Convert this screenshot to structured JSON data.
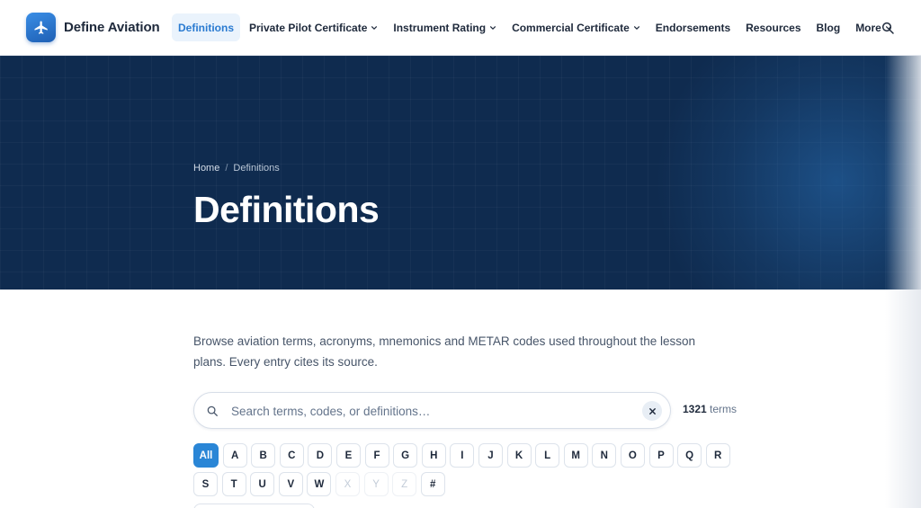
{
  "brand": {
    "name": "Define Aviation",
    "logo_icon": "airplane-icon",
    "accent": "#2a86d6"
  },
  "nav": {
    "items": [
      {
        "label": "Definitions",
        "active": true,
        "dropdown": false
      },
      {
        "label": "Private Pilot Certificate",
        "active": false,
        "dropdown": true
      },
      {
        "label": "Instrument Rating",
        "active": false,
        "dropdown": true
      },
      {
        "label": "Commercial Certificate",
        "active": false,
        "dropdown": true
      },
      {
        "label": "Endorsements",
        "active": false,
        "dropdown": false
      },
      {
        "label": "Resources",
        "active": false,
        "dropdown": false
      },
      {
        "label": "Blog",
        "active": false,
        "dropdown": false
      },
      {
        "label": "More",
        "active": false,
        "dropdown": true
      }
    ],
    "search_icon": "search-icon"
  },
  "hero": {
    "breadcrumb": {
      "home": "Home",
      "separator": "/",
      "current": "Definitions"
    },
    "title": "Definitions",
    "background": "#0f2b4f"
  },
  "intro": "Browse aviation terms, acronyms, mnemonics and METAR codes used throughout the lesson plans. Every entry cites its source.",
  "search": {
    "placeholder": "Search terms, codes, or definitions…",
    "value": "",
    "clear_icon": "close-icon"
  },
  "term_count": {
    "number": "1321",
    "label": "terms"
  },
  "alphabet": {
    "row1": [
      {
        "label": "All",
        "state": "active"
      },
      {
        "label": "A",
        "state": "enabled"
      },
      {
        "label": "B",
        "state": "enabled"
      },
      {
        "label": "C",
        "state": "enabled"
      },
      {
        "label": "D",
        "state": "enabled"
      },
      {
        "label": "E",
        "state": "enabled"
      },
      {
        "label": "F",
        "state": "enabled"
      },
      {
        "label": "G",
        "state": "enabled"
      },
      {
        "label": "H",
        "state": "enabled"
      },
      {
        "label": "I",
        "state": "enabled"
      },
      {
        "label": "J",
        "state": "enabled"
      },
      {
        "label": "K",
        "state": "enabled"
      },
      {
        "label": "L",
        "state": "enabled"
      },
      {
        "label": "M",
        "state": "enabled"
      },
      {
        "label": "N",
        "state": "enabled"
      },
      {
        "label": "O",
        "state": "enabled"
      },
      {
        "label": "P",
        "state": "enabled"
      },
      {
        "label": "Q",
        "state": "enabled"
      },
      {
        "label": "R",
        "state": "enabled"
      }
    ],
    "row2": [
      {
        "label": "S",
        "state": "enabled"
      },
      {
        "label": "T",
        "state": "enabled"
      },
      {
        "label": "U",
        "state": "enabled"
      },
      {
        "label": "V",
        "state": "enabled"
      },
      {
        "label": "W",
        "state": "enabled"
      },
      {
        "label": "X",
        "state": "disabled"
      },
      {
        "label": "Y",
        "state": "disabled"
      },
      {
        "label": "Z",
        "state": "disabled"
      },
      {
        "label": "#",
        "state": "enabled"
      }
    ]
  }
}
